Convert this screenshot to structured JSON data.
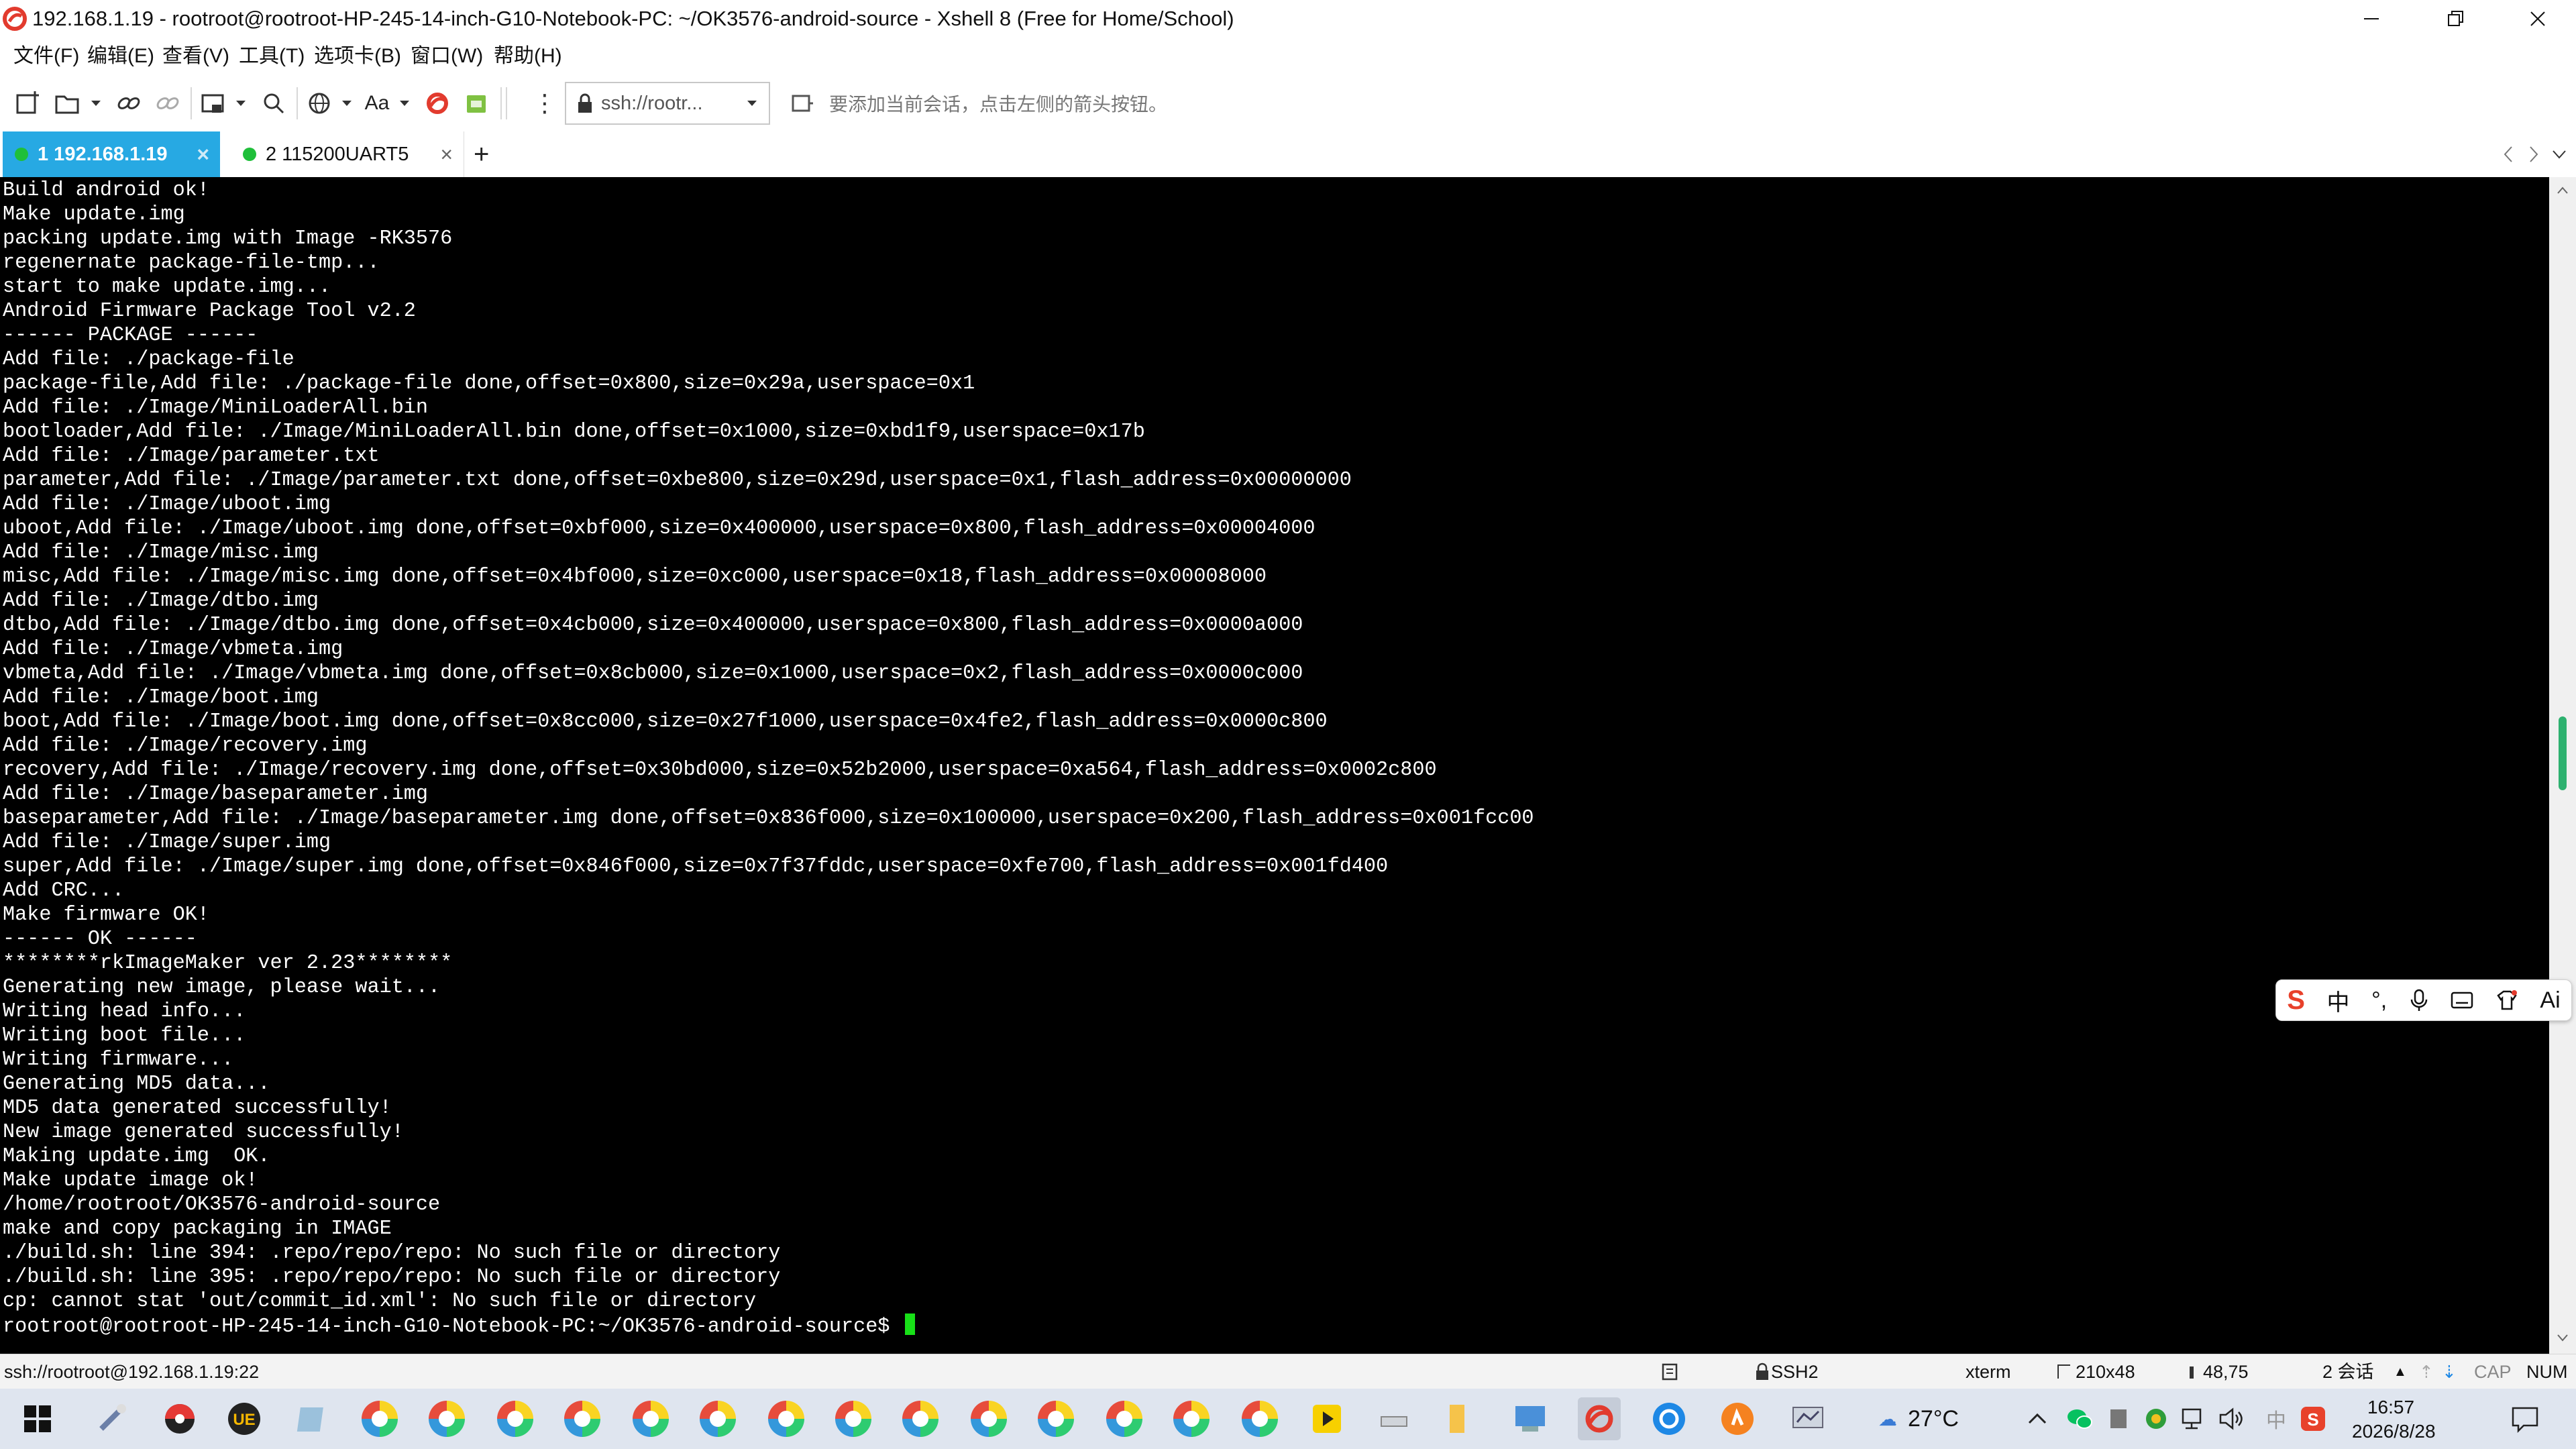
{
  "window": {
    "title": "192.168.1.19 - rootroot@rootroot-HP-245-14-inch-G10-Notebook-PC: ~/OK3576-android-source - Xshell 8 (Free for Home/School)"
  },
  "menu": {
    "items": [
      "文件(F)",
      "编辑(E)",
      "查看(V)",
      "工具(T)",
      "选项卡(B)",
      "窗口(W)",
      "帮助(H)"
    ]
  },
  "toolbar": {
    "address": "ssh://rootr...",
    "hint": "要添加当前会话，点击左侧的箭头按钮。",
    "font_label": "Aa"
  },
  "tabs": [
    {
      "label": "1 192.168.1.19",
      "active": true
    },
    {
      "label": "2 115200UART5",
      "active": false
    }
  ],
  "terminal": {
    "lines": [
      "Build android ok!",
      "Make update.img",
      "packing update.img with Image -RK3576",
      "regenernate package-file-tmp...",
      "start to make update.img...",
      "Android Firmware Package Tool v2.2",
      "------ PACKAGE ------",
      "Add file: ./package-file",
      "package-file,Add file: ./package-file done,offset=0x800,size=0x29a,userspace=0x1",
      "Add file: ./Image/MiniLoaderAll.bin",
      "bootloader,Add file: ./Image/MiniLoaderAll.bin done,offset=0x1000,size=0xbd1f9,userspace=0x17b",
      "Add file: ./Image/parameter.txt",
      "parameter,Add file: ./Image/parameter.txt done,offset=0xbe800,size=0x29d,userspace=0x1,flash_address=0x00000000",
      "Add file: ./Image/uboot.img",
      "uboot,Add file: ./Image/uboot.img done,offset=0xbf000,size=0x400000,userspace=0x800,flash_address=0x00004000",
      "Add file: ./Image/misc.img",
      "misc,Add file: ./Image/misc.img done,offset=0x4bf000,size=0xc000,userspace=0x18,flash_address=0x00008000",
      "Add file: ./Image/dtbo.img",
      "dtbo,Add file: ./Image/dtbo.img done,offset=0x4cb000,size=0x400000,userspace=0x800,flash_address=0x0000a000",
      "Add file: ./Image/vbmeta.img",
      "vbmeta,Add file: ./Image/vbmeta.img done,offset=0x8cb000,size=0x1000,userspace=0x2,flash_address=0x0000c000",
      "Add file: ./Image/boot.img",
      "boot,Add file: ./Image/boot.img done,offset=0x8cc000,size=0x27f1000,userspace=0x4fe2,flash_address=0x0000c800",
      "Add file: ./Image/recovery.img",
      "recovery,Add file: ./Image/recovery.img done,offset=0x30bd000,size=0x52b2000,userspace=0xa564,flash_address=0x0002c800",
      "Add file: ./Image/baseparameter.img",
      "baseparameter,Add file: ./Image/baseparameter.img done,offset=0x836f000,size=0x100000,userspace=0x200,flash_address=0x001fcc00",
      "Add file: ./Image/super.img",
      "super,Add file: ./Image/super.img done,offset=0x846f000,size=0x7f37fddc,userspace=0xfe700,flash_address=0x001fd400",
      "Add CRC...",
      "Make firmware OK!",
      "------ OK ------",
      "********rkImageMaker ver 2.23********",
      "Generating new image, please wait...",
      "Writing head info...",
      "Writing boot file...",
      "Writing firmware...",
      "Generating MD5 data...",
      "MD5 data generated successfully!",
      "New image generated successfully!",
      "Making update.img  OK.",
      "Make update image ok!",
      "/home/rootroot/OK3576-android-source",
      "make and copy packaging in IMAGE",
      "./build.sh: line 394: .repo/repo/repo: No such file or directory",
      "./build.sh: line 395: .repo/repo/repo: No such file or directory",
      "cp: cannot stat 'out/commit_id.xml': No such file or directory",
      "rootroot@rootroot-HP-245-14-inch-G10-Notebook-PC:~/OK3576-android-source$ "
    ]
  },
  "ime": {
    "mode": "中",
    "ai_label": "Ai"
  },
  "status": {
    "connection": "ssh://rootroot@192.168.1.19:22",
    "protocol": "SSH2",
    "terminal_type": "xterm",
    "size": "210x48",
    "cursor_pos": "48,75",
    "sessions": "2 会话",
    "cap": "CAP",
    "num": "NUM"
  },
  "taskbar": {
    "temperature": "27°C",
    "ime_lang": "中",
    "time": "16:57",
    "date": "2026/8/28"
  },
  "colors": {
    "tab_active": "#27a9e3",
    "session_dot": "#1fbf3a",
    "cursor": "#18e018",
    "terminal_bg": "#000000",
    "scroll_thumb": "#2db16f"
  }
}
